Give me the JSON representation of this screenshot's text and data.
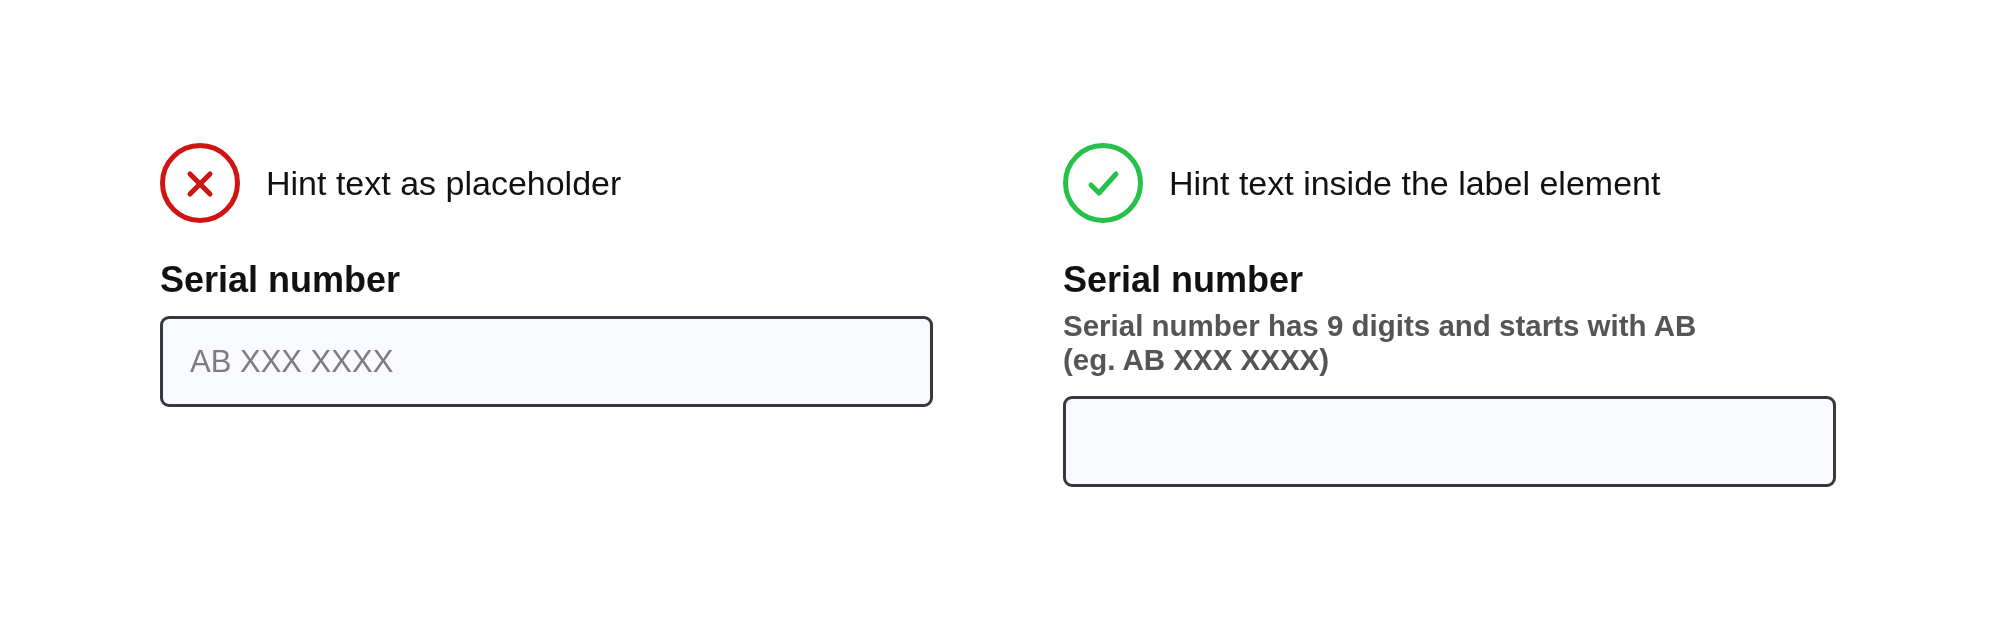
{
  "examples": [
    {
      "kind": "bad",
      "caption": "Hint text as placeholder",
      "field": {
        "label": "Serial number",
        "placeholder": "AB XXX XXXX"
      }
    },
    {
      "kind": "good",
      "caption": "Hint text inside the label element",
      "field": {
        "label": "Serial number",
        "hint": "Serial number has 9 digits and starts with AB\n(eg. AB XXX XXXX)"
      }
    }
  ]
}
